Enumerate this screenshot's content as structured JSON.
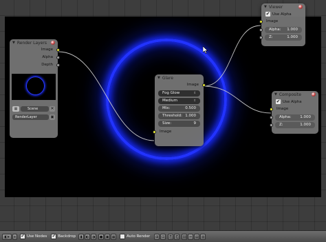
{
  "render_layers": {
    "title": "Render Layers",
    "outputs": [
      "Image",
      "Alpha",
      "Depth"
    ],
    "scene": "Scene",
    "layer": "RenderLayer"
  },
  "glare": {
    "title": "Glare",
    "output": "Image",
    "type": "Fog Glow",
    "quality": "Medium",
    "mix_label": "Mix:",
    "mix_value": "0.500",
    "threshold_label": "Threshold:",
    "threshold_value": "1.000",
    "size_label": "Size:",
    "size_value": "9",
    "input": "Image"
  },
  "viewer": {
    "title": "Viewer",
    "use_alpha": "Use Alpha",
    "input": "Image",
    "alpha_label": "Alpha:",
    "alpha_value": "1.000",
    "z_label": "Z:",
    "z_value": "1.000"
  },
  "composite": {
    "title": "Composite",
    "use_alpha": "Use Alpha",
    "input": "Image",
    "alpha_label": "Alpha:",
    "alpha_value": "1.000",
    "z_label": "Z:",
    "z_value": "1.000"
  },
  "header": {
    "use_nodes": "Use Nodes",
    "backdrop": "Backdrop",
    "auto_render": "Auto Render"
  },
  "colors": {
    "glow": "#2233ff",
    "socket_image": "#e6e632",
    "socket_value": "#a5a5a5"
  }
}
